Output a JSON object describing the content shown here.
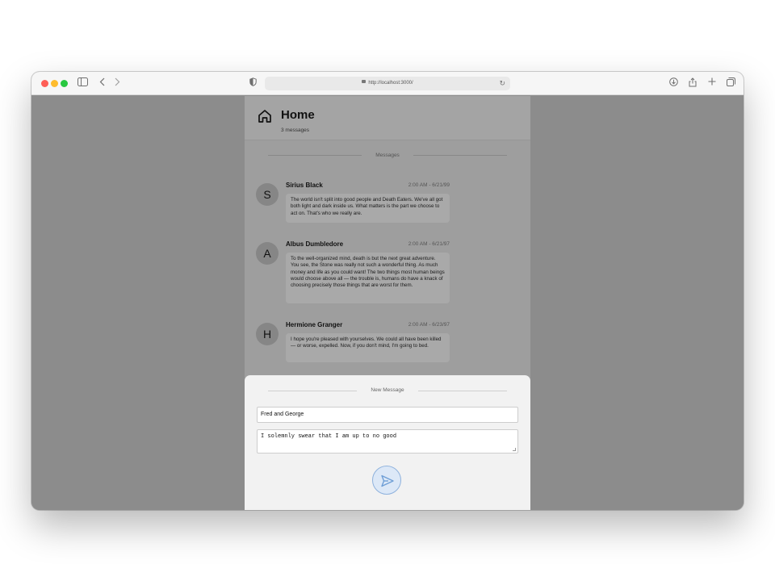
{
  "browser": {
    "url": "http://localhost:3000/",
    "icons": [
      "sidebar-icon",
      "back-icon",
      "forward-icon",
      "shield-icon",
      "lock-icon",
      "reload-icon",
      "download-icon",
      "share-icon",
      "new-tab-icon",
      "tabs-icon"
    ]
  },
  "header": {
    "title": "Home",
    "subtitle": "3 messages"
  },
  "messages_divider": "Messages",
  "messages": [
    {
      "initial": "S",
      "author": "Sirius Black",
      "time": "2:00 AM - 6/21/99",
      "text": "The world isn't split into good people and Death Eaters. We've all got both light and dark inside us. What matters is the part we choose to act on. That's who we really are."
    },
    {
      "initial": "A",
      "author": "Albus Dumbledore",
      "time": "2:00 AM - 6/21/97",
      "text": "To the well-organized mind, death is but the next great adventure. You see, the Stone was really not such a wonderful thing. As much money and life as you could want! The two things most human beings would choose above all — the trouble is, humans do have a knack of choosing precisely those things that are worst for them."
    },
    {
      "initial": "H",
      "author": "Hermione Granger",
      "time": "2:00 AM - 6/23/97",
      "text": "I hope you're pleased with yourselves. We could all have been killed — or worse, expelled. Now, if you don't mind, I'm going to bed."
    }
  ],
  "composer": {
    "divider": "New Message",
    "name_value": "Fred and George",
    "message_value": "I solemnly swear that I am up to no good"
  },
  "colors": {
    "overlay": "#8c8c8c",
    "send_button_bg": "#dce8f7",
    "send_button_accent": "#6f9fd6"
  }
}
